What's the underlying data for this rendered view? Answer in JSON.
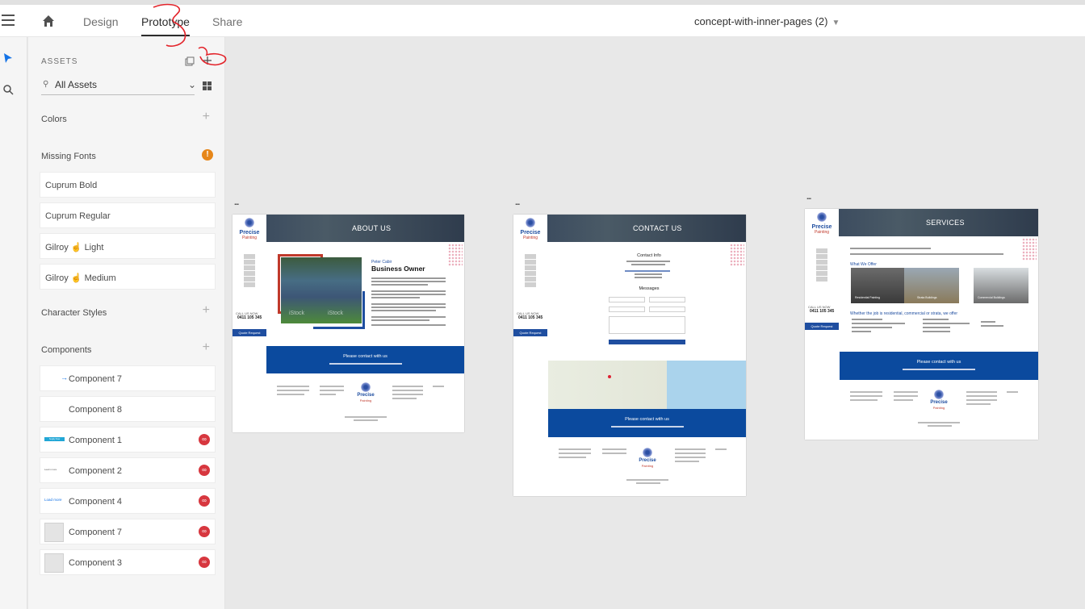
{
  "topbar": {
    "tabs": [
      {
        "label": "Design"
      },
      {
        "label": "Prototype"
      },
      {
        "label": "Share"
      }
    ],
    "document_title": "concept-with-inner-pages (2)"
  },
  "assets": {
    "title": "ASSETS",
    "filter_label": "All Assets",
    "sections": {
      "colors": "Colors",
      "missing_fonts": "Missing Fonts",
      "character_styles": "Character Styles",
      "components": "Components"
    },
    "missing_font_items": [
      {
        "label": "Cuprum Bold"
      },
      {
        "label": "Cuprum Regular"
      },
      {
        "prefix": "Gilroy",
        "suffix": "Light"
      },
      {
        "prefix": "Gilroy",
        "suffix": "Medium"
      }
    ],
    "components": [
      {
        "label": "Component 7"
      },
      {
        "label": "Component 8"
      },
      {
        "label": "Component 1",
        "thumb_text": "Supply Now"
      },
      {
        "label": "Component 2",
        "thumb_text": "Learn more"
      },
      {
        "label": "Component 4",
        "thumb_text": "Load more"
      },
      {
        "label": "Component 7"
      },
      {
        "label": "Component 3"
      }
    ]
  },
  "artboards": {
    "about": {
      "dots": "...",
      "header_title": "ABOUT US",
      "logo_name": "Precise",
      "logo_sub": "Painting",
      "call_label": "CALL US NOW",
      "phone": "0411 105 345",
      "quote_button": "Quote Request",
      "kicker": "Peter Cabir",
      "heading": "Business Owner",
      "stock1": "iStock",
      "stock2": "iStock",
      "band_title": "Please contact with us"
    },
    "contact": {
      "dots": "...",
      "header_title": "CONTACT US",
      "logo_name": "Precise",
      "logo_sub": "Painting",
      "call_label": "CALL US NOW",
      "phone": "0411 105 345",
      "quote_button": "Quote Request",
      "info_title": "Contact Info",
      "message_title": "Messages",
      "band_title": "Please contact with us",
      "footer_logo_name": "Precise",
      "footer_logo_sub": "Painting"
    },
    "services": {
      "dots": "...",
      "header_title": "SERVICES",
      "logo_name": "Precise",
      "logo_sub": "Painting",
      "call_label": "CALL US NOW",
      "phone": "0411 105 345",
      "quote_button": "Quote Request",
      "what_we_offer": "What We Offer",
      "thumbs": [
        {
          "label": "Residential Painting"
        },
        {
          "label": "Strata Buildings"
        },
        {
          "label": "Commercial Buildings"
        }
      ],
      "whether_line": "Whether the job is residential, commercial or strata, we offer",
      "band_title": "Please contact with us",
      "footer_logo_name": "Precise",
      "footer_logo_sub": "Painting"
    }
  },
  "colors": {
    "brand_blue": "#0b4a9e",
    "warning": "#e68619",
    "link_badge": "#d7373f",
    "annotation": "#e3242b"
  }
}
